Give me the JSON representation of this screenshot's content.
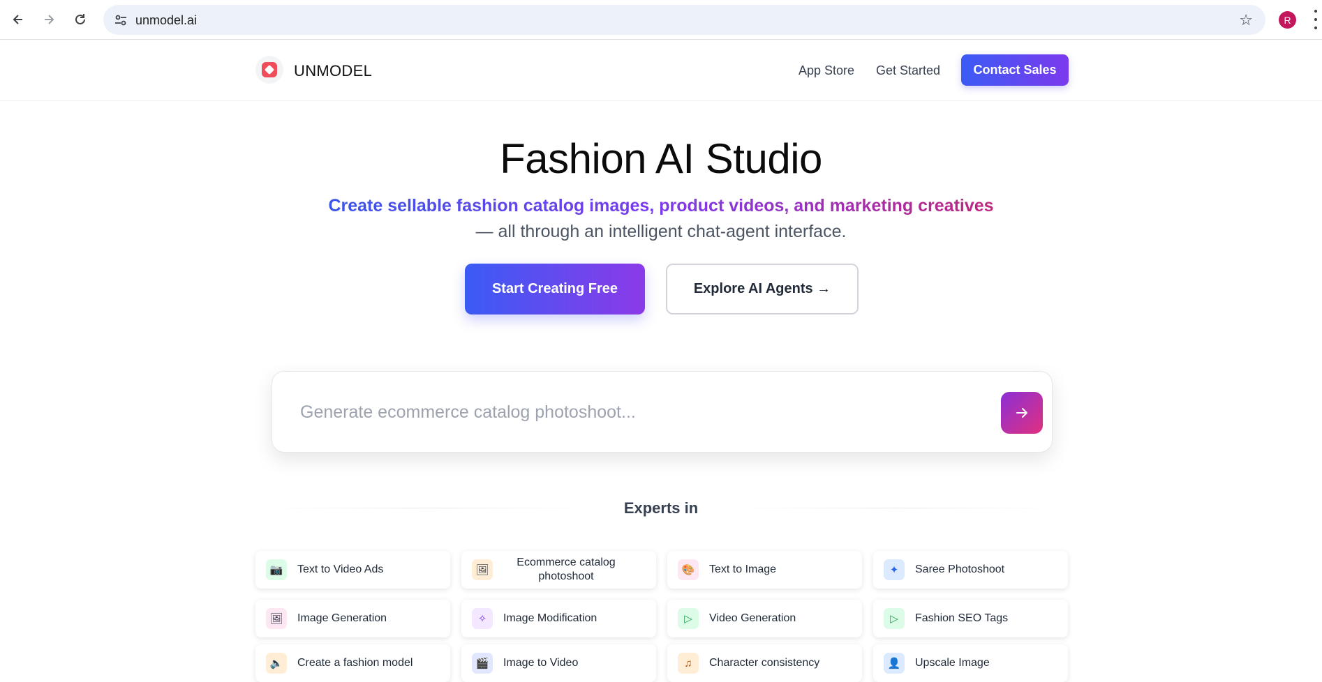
{
  "browser": {
    "url": "unmodel.ai",
    "profile_initial": "R"
  },
  "header": {
    "brand": "UNMODEL",
    "nav": [
      "App Store",
      "Get Started"
    ],
    "contact_label": "Contact Sales"
  },
  "hero": {
    "title": "Fashion AI Studio",
    "subtitle_gradient": "Create sellable fashion catalog images, product videos, and marketing creatives",
    "subtitle_rest": "— all through an intelligent chat-agent interface.",
    "primary_cta": "Start Creating Free",
    "secondary_cta": "Explore AI Agents →"
  },
  "prompt": {
    "placeholder": "Generate ecommerce catalog photoshoot..."
  },
  "experts": {
    "title": "Experts in",
    "cards": [
      {
        "label": "Text to Video Ads",
        "icon": "camera-icon",
        "icon_bg": "#dcfce7"
      },
      {
        "label": "Ecommerce catalog photoshoot",
        "icon": "image-icon",
        "icon_bg": "#ffedd5"
      },
      {
        "label": "Text to Image",
        "icon": "palette-icon",
        "icon_bg": "#fce7f3"
      },
      {
        "label": "Saree Photoshoot",
        "icon": "sparkle-icon",
        "icon_bg": "#dbeafe"
      },
      {
        "label": "Image Generation",
        "icon": "image-icon",
        "icon_bg": "#fce7f3"
      },
      {
        "label": "Image Modification",
        "icon": "magic-wand-icon",
        "icon_bg": "#f3e8ff"
      },
      {
        "label": "Video Generation",
        "icon": "play-icon",
        "icon_bg": "#dcfce7"
      },
      {
        "label": "Fashion SEO Tags",
        "icon": "play-icon",
        "icon_bg": "#dcfce7"
      },
      {
        "label": "Create a fashion model",
        "icon": "speaker-icon",
        "icon_bg": "#ffedd5"
      },
      {
        "label": "Image to Video",
        "icon": "clapper-icon",
        "icon_bg": "#e0e7ff"
      },
      {
        "label": "Character consistency",
        "icon": "music-note-icon",
        "icon_bg": "#ffedd5"
      },
      {
        "label": "Upscale Image",
        "icon": "users-icon",
        "icon_bg": "#dbeafe"
      }
    ]
  }
}
